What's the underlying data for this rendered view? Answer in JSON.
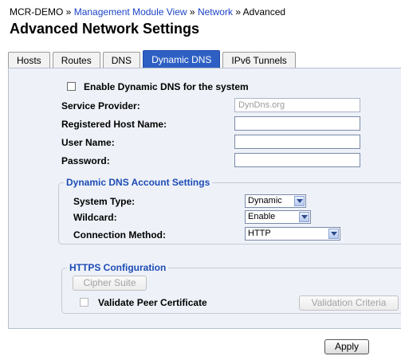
{
  "breadcrumb": {
    "root": "MCR-DEMO",
    "items": [
      "Management Module View",
      "Network"
    ],
    "current": "Advanced",
    "separator": "»"
  },
  "page_title": "Advanced Network Settings",
  "tabs": [
    {
      "label": "Hosts",
      "active": false
    },
    {
      "label": "Routes",
      "active": false
    },
    {
      "label": "DNS",
      "active": false
    },
    {
      "label": "Dynamic DNS",
      "active": true
    },
    {
      "label": "IPv6 Tunnels",
      "active": false
    }
  ],
  "form": {
    "enable_label": "Enable Dynamic DNS for the system",
    "enable_checked": false,
    "service_provider": {
      "label": "Service Provider:",
      "value": "DynDns.org"
    },
    "host_name": {
      "label": "Registered Host Name:",
      "value": ""
    },
    "user_name": {
      "label": "User Name:",
      "value": ""
    },
    "password": {
      "label": "Password:",
      "value": ""
    }
  },
  "account": {
    "legend": "Dynamic DNS Account Settings",
    "system_type": {
      "label": "System Type:",
      "value": "Dynamic"
    },
    "wildcard": {
      "label": "Wildcard:",
      "value": "Enable"
    },
    "connection_method": {
      "label": "Connection Method:",
      "value": "HTTP"
    }
  },
  "https": {
    "legend": "HTTPS Configuration",
    "cipher_suite": "Cipher Suite",
    "validate_label": "Validate Peer Certificate",
    "validate_checked": false,
    "validation_criteria": "Validation Criteria"
  },
  "apply_label": "Apply",
  "colors": {
    "accent": "#2e60c4",
    "link": "#1c44c8",
    "legend": "#1d4bb5",
    "panel": "#eef2f8"
  }
}
